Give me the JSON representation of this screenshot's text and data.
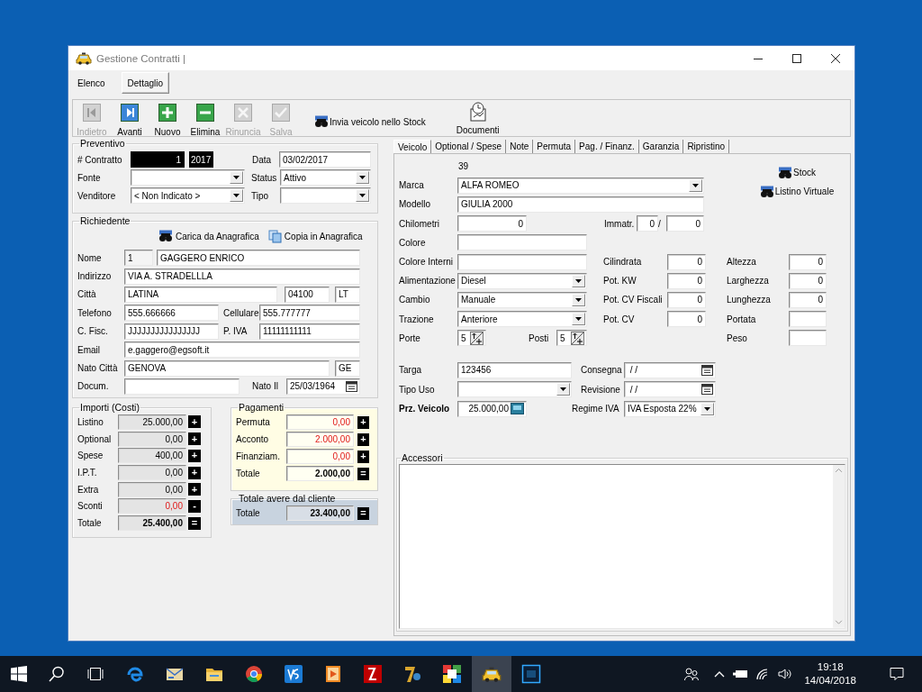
{
  "window": {
    "title": "Gestione Contratti |"
  },
  "view_tabs": [
    {
      "label": "Elenco",
      "selected": false
    },
    {
      "label": "Dettaglio",
      "selected": true
    }
  ],
  "toolbar": [
    {
      "kind": "back",
      "label": "Indietro",
      "disabled": true
    },
    {
      "kind": "forward",
      "label": "Avanti",
      "disabled": false
    },
    {
      "kind": "add",
      "label": "Nuovo",
      "disabled": false
    },
    {
      "kind": "remove",
      "label": "Elimina",
      "disabled": false
    },
    {
      "kind": "cancel",
      "label": "Rinuncia",
      "disabled": true
    },
    {
      "kind": "save",
      "label": "Salva",
      "disabled": true
    }
  ],
  "toolbar_actions": [
    {
      "kind": "stock",
      "label": "Invia veicolo nello Stock"
    },
    {
      "kind": "documents",
      "label": "Documenti"
    }
  ],
  "preventivo": {
    "title": "Preventivo",
    "rows": [
      {
        "items": [
          {
            "kind": "label",
            "text": "# Contratto"
          },
          {
            "kind": "counter",
            "value": "1"
          },
          {
            "kind": "year",
            "value": "2017"
          },
          {
            "kind": "label",
            "text": "Data"
          },
          {
            "kind": "text",
            "value": "03/02/2017"
          }
        ]
      },
      {
        "items": [
          {
            "kind": "label",
            "text": "Fonte"
          },
          {
            "kind": "combo"
          },
          {
            "kind": "label",
            "text": "Status"
          },
          {
            "kind": "combo",
            "value": "Attivo"
          }
        ]
      },
      {
        "items": [
          {
            "kind": "label",
            "text": "Venditore"
          },
          {
            "kind": "combo",
            "value": "< Non Indicato >"
          },
          {
            "kind": "label",
            "text": "Tipo"
          },
          {
            "kind": "combo"
          }
        ]
      }
    ]
  },
  "richiedente": {
    "title": "Richiedente",
    "actions": [
      {
        "kind": "lookup",
        "text": "Carica da Anagrafica"
      },
      {
        "kind": "copy",
        "text": "Copia in Anagrafica"
      }
    ],
    "rows": [
      {
        "items": [
          {
            "kind": "label",
            "text": "Nome"
          },
          {
            "kind": "readonly",
            "value": "1"
          },
          {
            "kind": "text",
            "value": "GAGGERO ENRICO"
          }
        ]
      },
      {
        "items": [
          {
            "kind": "label",
            "text": "Indirizzo"
          },
          {
            "kind": "text",
            "value": "VIA A. STRADELLLA"
          }
        ]
      },
      {
        "items": [
          {
            "kind": "label",
            "text": "Città"
          },
          {
            "kind": "text",
            "value": "LATINA"
          },
          {
            "kind": "text",
            "value": "04100"
          },
          {
            "kind": "text",
            "value": "LT"
          }
        ]
      },
      {
        "items": [
          {
            "kind": "label",
            "text": "Telefono"
          },
          {
            "kind": "text",
            "value": "555.666666"
          },
          {
            "kind": "label",
            "text": "Cellulare"
          },
          {
            "kind": "text",
            "value": "555.777777"
          }
        ]
      },
      {
        "items": [
          {
            "kind": "label",
            "text": "C. Fisc."
          },
          {
            "kind": "text",
            "value": "JJJJJJJJJJJJJJJJ"
          },
          {
            "kind": "label",
            "text": "P. IVA"
          },
          {
            "kind": "text",
            "value": "11111111111"
          }
        ]
      },
      {
        "items": [
          {
            "kind": "label",
            "text": "Email"
          },
          {
            "kind": "text",
            "value": "e.gaggero@egsoft.it"
          }
        ]
      },
      {
        "items": [
          {
            "kind": "label",
            "text": "Nato Città"
          },
          {
            "kind": "text",
            "value": "GENOVA"
          },
          {
            "kind": "text",
            "value": "GE"
          }
        ]
      },
      {
        "items": [
          {
            "kind": "label",
            "text": "Docum."
          },
          {
            "kind": "text"
          },
          {
            "kind": "label",
            "text": "Nato Il"
          },
          {
            "kind": "date",
            "value": "25/03/1964"
          }
        ]
      }
    ]
  },
  "importi": {
    "title": "Importi (Costi)",
    "rows": [
      {
        "label": "Listino",
        "value": "25.000,00",
        "emphasis": false,
        "total": false,
        "op": "+"
      },
      {
        "label": "Optional",
        "value": "0,00",
        "emphasis": false,
        "total": false,
        "op": "+"
      },
      {
        "label": "Spese",
        "value": "400,00",
        "emphasis": false,
        "total": false,
        "op": "+"
      },
      {
        "label": "I.P.T.",
        "value": "0,00",
        "emphasis": false,
        "total": false,
        "op": "+"
      },
      {
        "label": "Extra",
        "value": "0,00",
        "emphasis": false,
        "total": false,
        "op": "+"
      },
      {
        "label": "Sconti",
        "value": "0,00",
        "emphasis": true,
        "total": false,
        "op": "-"
      },
      {
        "label": "Totale",
        "value": "25.400,00",
        "emphasis": false,
        "total": true,
        "op": "="
      }
    ]
  },
  "pagamenti": {
    "title": "Pagamenti",
    "rows": [
      {
        "label": "Permuta",
        "value": "0,00",
        "emphasis": true,
        "total": false,
        "op": "+"
      },
      {
        "label": "Acconto",
        "value": "2.000,00",
        "emphasis": true,
        "total": false,
        "op": "+"
      },
      {
        "label": "Finanziam.",
        "value": "0,00",
        "emphasis": true,
        "total": false,
        "op": "+"
      },
      {
        "label": "Totale",
        "value": "2.000,00",
        "emphasis": false,
        "total": true,
        "op": "="
      }
    ]
  },
  "totale_avere": {
    "title": "Totale avere dal cliente",
    "rows": [
      {
        "label": "Totale",
        "value": "23.400,00",
        "emphasis": false,
        "total": true,
        "op": "="
      }
    ]
  },
  "vehicle_tabs": [
    {
      "label": "Veicolo",
      "selected": true
    },
    {
      "label": "Optional / Spese",
      "selected": false
    },
    {
      "label": "Note",
      "selected": false
    },
    {
      "label": "Permuta",
      "selected": false
    },
    {
      "label": "Pag. / Finanz.",
      "selected": false
    },
    {
      "label": "Garanzia",
      "selected": false
    },
    {
      "label": "Ripristino",
      "selected": false
    }
  ],
  "vehicle": {
    "header_rows": [
      {
        "items": [
          {
            "kind": "caption",
            "text": "39"
          }
        ]
      },
      {
        "items": [
          {
            "kind": "label",
            "text": "Marca"
          },
          {
            "kind": "combo",
            "value": "ALFA ROMEO"
          }
        ]
      },
      {
        "items": [
          {
            "kind": "label",
            "text": "Modello"
          },
          {
            "kind": "text",
            "value": "GIULIA 2000"
          }
        ]
      }
    ],
    "lookup_buttons": [
      {
        "label": "Stock"
      },
      {
        "label": "Listino Virtuale"
      }
    ],
    "spec_rows": [
      {
        "items": [
          {
            "kind": "label",
            "text": "Chilometri"
          },
          {
            "kind": "number",
            "value": "0"
          },
          {
            "kind": "label",
            "text": "Immatr."
          },
          {
            "kind": "number",
            "value": "0"
          },
          {
            "kind": "label",
            "text": "/"
          },
          {
            "kind": "number",
            "value": "0"
          }
        ]
      },
      {
        "items": [
          {
            "kind": "label",
            "text": "Colore"
          },
          {
            "kind": "text"
          }
        ]
      },
      {
        "items": [
          {
            "kind": "label",
            "text": "Colore Interni"
          },
          {
            "kind": "text"
          },
          {
            "kind": "label",
            "text": "Cilindrata"
          },
          {
            "kind": "number",
            "value": "0"
          },
          {
            "kind": "label",
            "text": "Altezza"
          },
          {
            "kind": "number",
            "value": "0"
          }
        ]
      },
      {
        "items": [
          {
            "kind": "label",
            "text": "Alimentazione"
          },
          {
            "kind": "combo",
            "value": "Diesel"
          },
          {
            "kind": "label",
            "text": "Pot. KW"
          },
          {
            "kind": "number",
            "value": "0"
          },
          {
            "kind": "label",
            "text": "Larghezza"
          },
          {
            "kind": "number",
            "value": "0"
          }
        ]
      },
      {
        "items": [
          {
            "kind": "label",
            "text": "Cambio"
          },
          {
            "kind": "combo",
            "value": "Manuale"
          },
          {
            "kind": "label",
            "text": "Pot. CV Fiscali"
          },
          {
            "kind": "number",
            "value": "0"
          },
          {
            "kind": "label",
            "text": "Lunghezza"
          },
          {
            "kind": "number",
            "value": "0"
          }
        ]
      },
      {
        "items": [
          {
            "kind": "label",
            "text": "Trazione"
          },
          {
            "kind": "combo",
            "value": "Anteriore"
          },
          {
            "kind": "label",
            "text": "Pot. CV"
          },
          {
            "kind": "number",
            "value": "0"
          },
          {
            "kind": "label",
            "text": "Portata"
          },
          {
            "kind": "number"
          }
        ]
      },
      {
        "items": [
          {
            "kind": "label",
            "text": "Porte"
          },
          {
            "kind": "spin",
            "value": "5"
          },
          {
            "kind": "label",
            "text": "Posti"
          },
          {
            "kind": "spin",
            "value": "5"
          },
          {
            "kind": "label",
            "text": "Peso"
          },
          {
            "kind": "number"
          }
        ]
      }
    ],
    "sale_rows": [
      {
        "items": [
          {
            "kind": "label",
            "text": "Targa"
          },
          {
            "kind": "text",
            "value": "123456"
          },
          {
            "kind": "label",
            "text": "Consegna"
          },
          {
            "kind": "date",
            "value": " / /"
          }
        ]
      },
      {
        "items": [
          {
            "kind": "label",
            "text": "Tipo Uso"
          },
          {
            "kind": "combo"
          },
          {
            "kind": "label",
            "text": "Revisione"
          },
          {
            "kind": "date",
            "value": " / /"
          }
        ]
      },
      {
        "items": [
          {
            "kind": "strong",
            "text": "Prz. Veicolo"
          },
          {
            "kind": "price",
            "value": "25.000,00"
          },
          {
            "kind": "label",
            "text": "Regime IVA"
          },
          {
            "kind": "combo",
            "value": "IVA Esposta 22%"
          }
        ]
      }
    ],
    "accessori": {
      "title": "Accessori"
    }
  },
  "taskbar": {
    "apps": [
      {
        "kind": "edge",
        "selected": false
      },
      {
        "kind": "mail",
        "selected": false
      },
      {
        "kind": "folder",
        "selected": false
      },
      {
        "kind": "chrome",
        "selected": false
      },
      {
        "kind": "vs",
        "selected": false
      },
      {
        "kind": "player",
        "selected": false
      },
      {
        "kind": "ftp",
        "selected": false
      },
      {
        "kind": "zip",
        "selected": false
      },
      {
        "kind": "mosaic",
        "selected": false
      },
      {
        "kind": "taxi",
        "selected": true
      },
      {
        "kind": "ps",
        "selected": false
      }
    ],
    "time": "19:18",
    "date": "14/04/2018"
  }
}
